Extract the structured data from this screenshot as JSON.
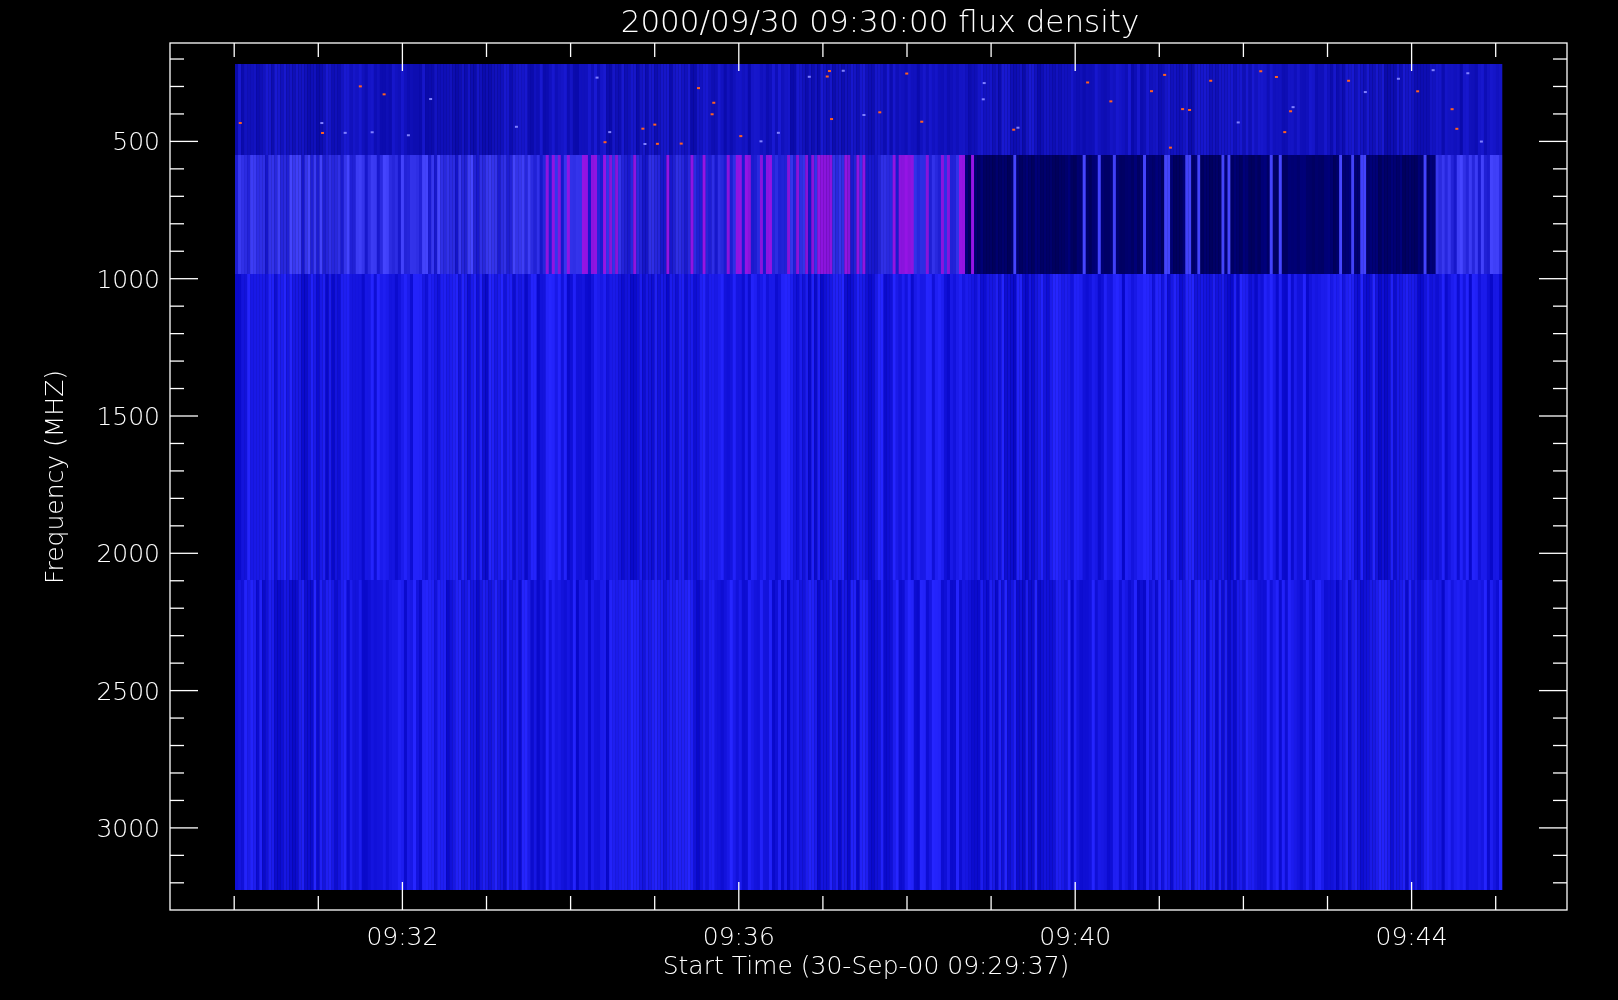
{
  "plot": {
    "title": "2000/09/30 09:30:00 flux density",
    "y_axis": {
      "label": "Frequency (MHZ)",
      "ticks": [
        "500",
        "1000",
        "1500",
        "2000",
        "2500",
        "3000"
      ]
    },
    "x_axis": {
      "label": "Start Time (30-Sep-00 09:29:37)",
      "ticks": [
        "09:32",
        "09:36",
        "09:40",
        "09:44"
      ]
    }
  }
}
